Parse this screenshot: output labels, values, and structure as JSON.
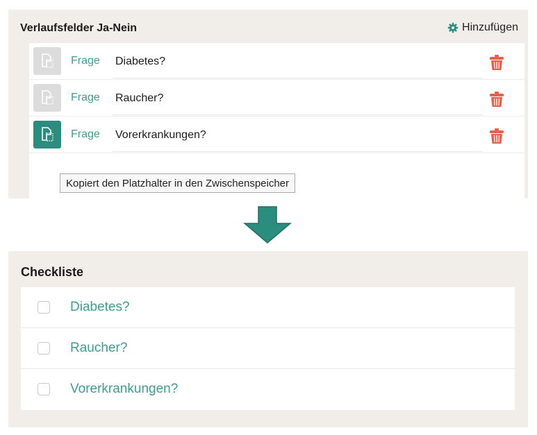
{
  "top_panel": {
    "title": "Verlaufsfelder Ja-Nein",
    "add_label": "Hinzufügen",
    "rows": [
      {
        "prefix": "Frage",
        "question": "Diabetes?",
        "copy_active": false
      },
      {
        "prefix": "Frage",
        "question": "Raucher?",
        "copy_active": false
      },
      {
        "prefix": "Frage",
        "question": "Vorerkrankungen?",
        "copy_active": true
      }
    ],
    "tooltip": "Kopiert den Platzhalter in den Zwischenspeicher"
  },
  "bottom_panel": {
    "title": "Checkliste",
    "items": [
      {
        "label": "Diabetes?",
        "checked": false
      },
      {
        "label": "Raucher?",
        "checked": false
      },
      {
        "label": "Vorerkrankungen?",
        "checked": false
      }
    ]
  },
  "colors": {
    "accent": "#2a8d7d",
    "link_text": "#3a9f92",
    "trash": "#e8604a",
    "panel_bg": "#f1ede9"
  },
  "icons": {
    "add": "gear-icon",
    "copy": "copy-placeholder-icon",
    "delete": "trash-icon",
    "transform": "arrow-down-icon",
    "checkbox": "checkbox-icon"
  }
}
